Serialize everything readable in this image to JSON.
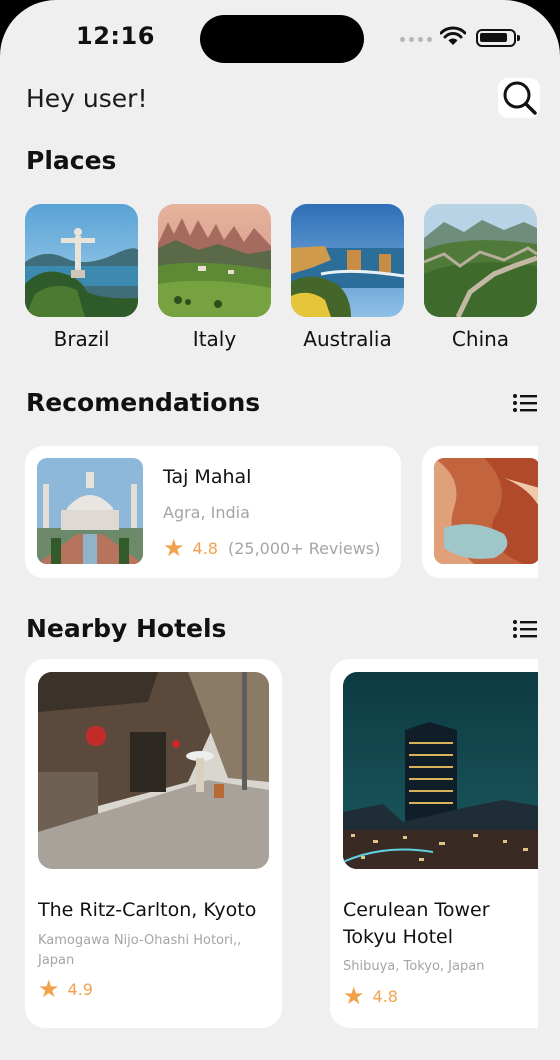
{
  "status_bar": {
    "time": "12:16"
  },
  "header": {
    "greeting": "Hey user!"
  },
  "places": {
    "title": "Places",
    "items": [
      {
        "name": "Brazil"
      },
      {
        "name": "Italy"
      },
      {
        "name": "Australia"
      },
      {
        "name": "China"
      }
    ]
  },
  "recommendations": {
    "title": "Recomendations",
    "items": [
      {
        "title": "Taj Mahal",
        "location": "Agra, India",
        "rating": "4.8",
        "reviews": "(25,000+ Reviews)"
      }
    ]
  },
  "hotels": {
    "title": "Nearby Hotels",
    "items": [
      {
        "name": "The Ritz-Carlton, Kyoto",
        "location": "Kamogawa Nijo-Ohashi Hotori,, Japan",
        "rating": "4.9"
      },
      {
        "name": " Cerulean Tower Tokyu Hotel",
        "location": "Shibuya, Tokyo, Japan",
        "rating": "4.8"
      }
    ]
  },
  "colors": {
    "accent_star": "#f2a24a",
    "background": "#efefef",
    "card": "#ffffff",
    "muted_text": "#a5a5a5"
  },
  "icons": [
    "search-icon",
    "list-icon",
    "star-icon",
    "wifi-icon",
    "battery-icon",
    "signal-icon"
  ]
}
